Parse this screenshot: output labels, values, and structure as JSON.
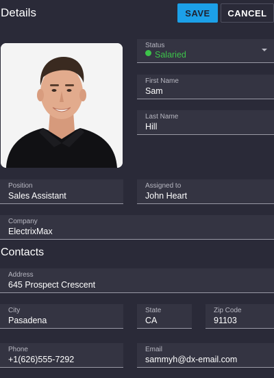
{
  "header": {
    "title": "Details",
    "save_label": "SAVE",
    "cancel_label": "CANCEL"
  },
  "status": {
    "label": "Status",
    "value": "Salaried",
    "color": "#3dc34a"
  },
  "first_name": {
    "label": "First Name",
    "value": "Sam"
  },
  "last_name": {
    "label": "Last Name",
    "value": "Hill"
  },
  "position": {
    "label": "Position",
    "value": "Sales Assistant"
  },
  "assigned_to": {
    "label": "Assigned to",
    "value": "John Heart"
  },
  "company": {
    "label": "Company",
    "value": "ElectrixMax"
  },
  "contacts": {
    "title": "Contacts",
    "address": {
      "label": "Address",
      "value": "645 Prospect Crescent"
    },
    "city": {
      "label": "City",
      "value": "Pasadena"
    },
    "state": {
      "label": "State",
      "value": "CA"
    },
    "zip": {
      "label": "Zip Code",
      "value": "91103"
    },
    "phone": {
      "label": "Phone",
      "value": "+1(626)555-7292"
    },
    "email": {
      "label": "Email",
      "value": "sammyh@dx-email.com"
    }
  },
  "icons": {
    "status_indicator": "dot-icon",
    "dropdown": "chevron-down-icon"
  },
  "colors": {
    "background": "#2a2a38",
    "field": "#343442",
    "accent": "#1ca0e8"
  }
}
